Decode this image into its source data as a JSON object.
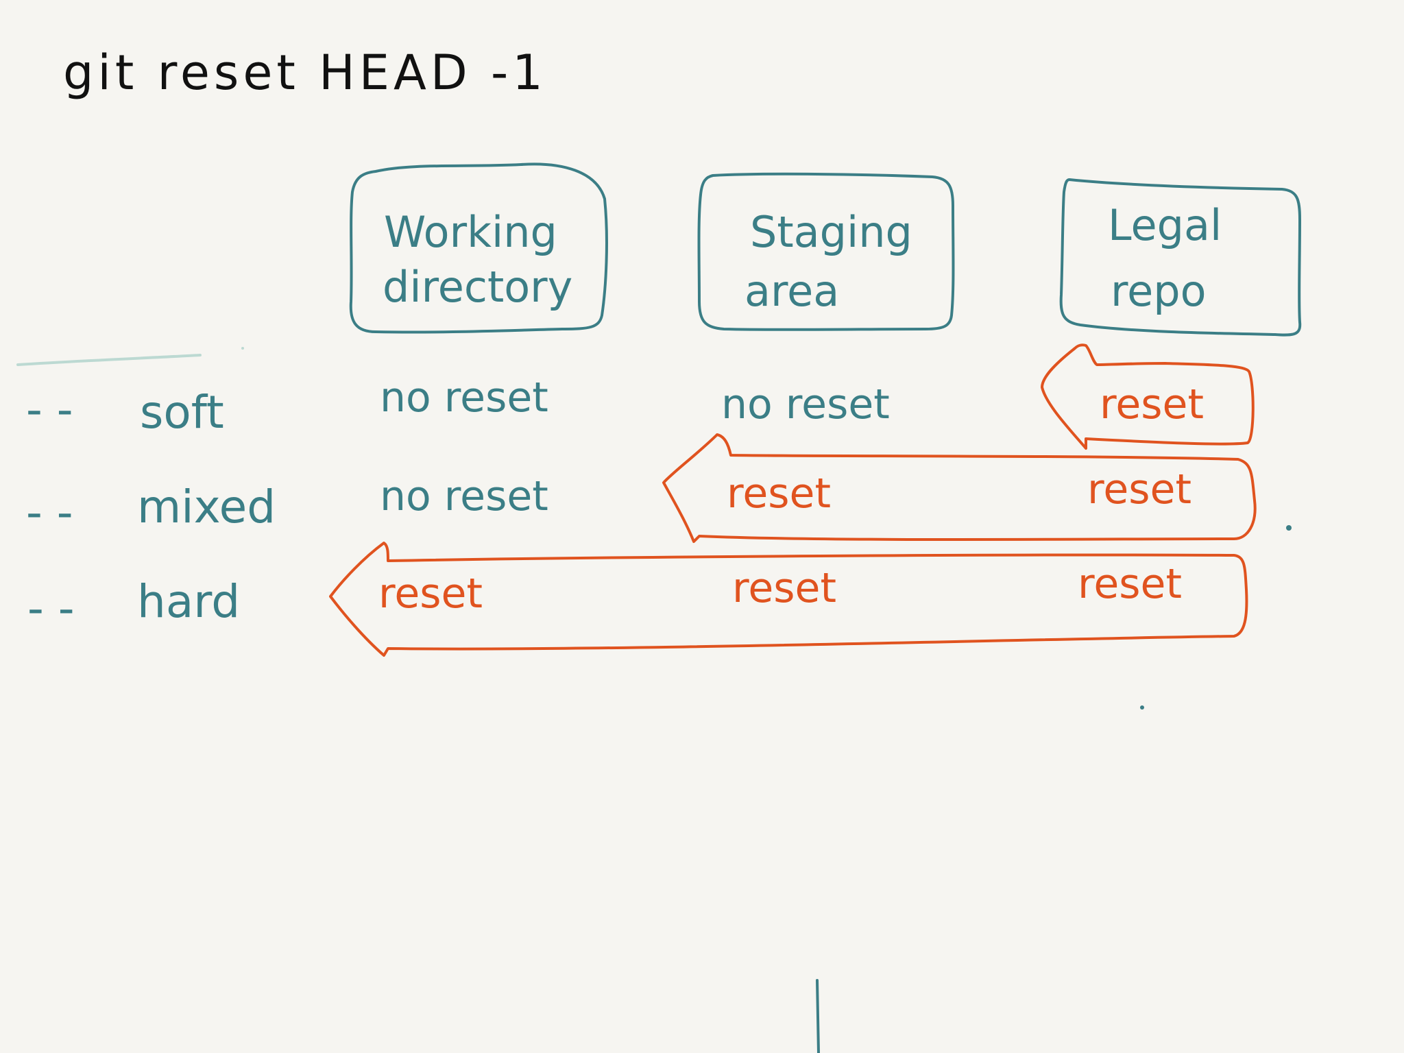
{
  "title": "git reset HEAD -1",
  "colors": {
    "background": "#f6f5f1",
    "ink": "#111111",
    "teal": "#3b7e86",
    "orange": "#e0531f",
    "light_teal": "#bcd9d2"
  },
  "areas": [
    {
      "line1": "Working",
      "line2": "directory"
    },
    {
      "line1": "Staging",
      "line2": "area"
    },
    {
      "line1": "Legal",
      "line2": "repo"
    }
  ],
  "rows": [
    {
      "label": "soft",
      "dash": "- -",
      "cells": [
        "no reset",
        "no reset",
        "reset"
      ]
    },
    {
      "label": "mixed",
      "dash": "- -",
      "cells": [
        "no reset",
        "reset",
        "reset"
      ]
    },
    {
      "label": "hard",
      "dash": "- -",
      "cells": [
        "reset",
        "reset",
        "reset"
      ]
    }
  ]
}
